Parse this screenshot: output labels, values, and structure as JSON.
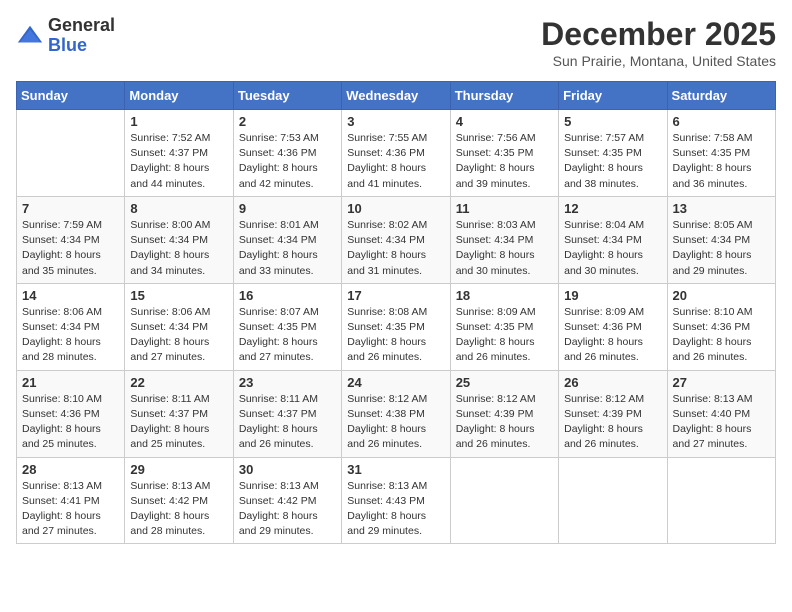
{
  "header": {
    "logo": {
      "general": "General",
      "blue": "Blue"
    },
    "title": "December 2025",
    "subtitle": "Sun Prairie, Montana, United States"
  },
  "weekdays": [
    "Sunday",
    "Monday",
    "Tuesday",
    "Wednesday",
    "Thursday",
    "Friday",
    "Saturday"
  ],
  "weeks": [
    [
      {
        "day": null
      },
      {
        "day": "1",
        "sunrise": "7:52 AM",
        "sunset": "4:37 PM",
        "daylight": "8 hours and 44 minutes."
      },
      {
        "day": "2",
        "sunrise": "7:53 AM",
        "sunset": "4:36 PM",
        "daylight": "8 hours and 42 minutes."
      },
      {
        "day": "3",
        "sunrise": "7:55 AM",
        "sunset": "4:36 PM",
        "daylight": "8 hours and 41 minutes."
      },
      {
        "day": "4",
        "sunrise": "7:56 AM",
        "sunset": "4:35 PM",
        "daylight": "8 hours and 39 minutes."
      },
      {
        "day": "5",
        "sunrise": "7:57 AM",
        "sunset": "4:35 PM",
        "daylight": "8 hours and 38 minutes."
      },
      {
        "day": "6",
        "sunrise": "7:58 AM",
        "sunset": "4:35 PM",
        "daylight": "8 hours and 36 minutes."
      }
    ],
    [
      {
        "day": "7",
        "sunrise": "7:59 AM",
        "sunset": "4:34 PM",
        "daylight": "8 hours and 35 minutes."
      },
      {
        "day": "8",
        "sunrise": "8:00 AM",
        "sunset": "4:34 PM",
        "daylight": "8 hours and 34 minutes."
      },
      {
        "day": "9",
        "sunrise": "8:01 AM",
        "sunset": "4:34 PM",
        "daylight": "8 hours and 33 minutes."
      },
      {
        "day": "10",
        "sunrise": "8:02 AM",
        "sunset": "4:34 PM",
        "daylight": "8 hours and 31 minutes."
      },
      {
        "day": "11",
        "sunrise": "8:03 AM",
        "sunset": "4:34 PM",
        "daylight": "8 hours and 30 minutes."
      },
      {
        "day": "12",
        "sunrise": "8:04 AM",
        "sunset": "4:34 PM",
        "daylight": "8 hours and 30 minutes."
      },
      {
        "day": "13",
        "sunrise": "8:05 AM",
        "sunset": "4:34 PM",
        "daylight": "8 hours and 29 minutes."
      }
    ],
    [
      {
        "day": "14",
        "sunrise": "8:06 AM",
        "sunset": "4:34 PM",
        "daylight": "8 hours and 28 minutes."
      },
      {
        "day": "15",
        "sunrise": "8:06 AM",
        "sunset": "4:34 PM",
        "daylight": "8 hours and 27 minutes."
      },
      {
        "day": "16",
        "sunrise": "8:07 AM",
        "sunset": "4:35 PM",
        "daylight": "8 hours and 27 minutes."
      },
      {
        "day": "17",
        "sunrise": "8:08 AM",
        "sunset": "4:35 PM",
        "daylight": "8 hours and 26 minutes."
      },
      {
        "day": "18",
        "sunrise": "8:09 AM",
        "sunset": "4:35 PM",
        "daylight": "8 hours and 26 minutes."
      },
      {
        "day": "19",
        "sunrise": "8:09 AM",
        "sunset": "4:36 PM",
        "daylight": "8 hours and 26 minutes."
      },
      {
        "day": "20",
        "sunrise": "8:10 AM",
        "sunset": "4:36 PM",
        "daylight": "8 hours and 26 minutes."
      }
    ],
    [
      {
        "day": "21",
        "sunrise": "8:10 AM",
        "sunset": "4:36 PM",
        "daylight": "8 hours and 25 minutes."
      },
      {
        "day": "22",
        "sunrise": "8:11 AM",
        "sunset": "4:37 PM",
        "daylight": "8 hours and 25 minutes."
      },
      {
        "day": "23",
        "sunrise": "8:11 AM",
        "sunset": "4:37 PM",
        "daylight": "8 hours and 26 minutes."
      },
      {
        "day": "24",
        "sunrise": "8:12 AM",
        "sunset": "4:38 PM",
        "daylight": "8 hours and 26 minutes."
      },
      {
        "day": "25",
        "sunrise": "8:12 AM",
        "sunset": "4:39 PM",
        "daylight": "8 hours and 26 minutes."
      },
      {
        "day": "26",
        "sunrise": "8:12 AM",
        "sunset": "4:39 PM",
        "daylight": "8 hours and 26 minutes."
      },
      {
        "day": "27",
        "sunrise": "8:13 AM",
        "sunset": "4:40 PM",
        "daylight": "8 hours and 27 minutes."
      }
    ],
    [
      {
        "day": "28",
        "sunrise": "8:13 AM",
        "sunset": "4:41 PM",
        "daylight": "8 hours and 27 minutes."
      },
      {
        "day": "29",
        "sunrise": "8:13 AM",
        "sunset": "4:42 PM",
        "daylight": "8 hours and 28 minutes."
      },
      {
        "day": "30",
        "sunrise": "8:13 AM",
        "sunset": "4:42 PM",
        "daylight": "8 hours and 29 minutes."
      },
      {
        "day": "31",
        "sunrise": "8:13 AM",
        "sunset": "4:43 PM",
        "daylight": "8 hours and 29 minutes."
      },
      {
        "day": null
      },
      {
        "day": null
      },
      {
        "day": null
      }
    ]
  ],
  "labels": {
    "sunrise": "Sunrise:",
    "sunset": "Sunset:",
    "daylight": "Daylight:"
  }
}
